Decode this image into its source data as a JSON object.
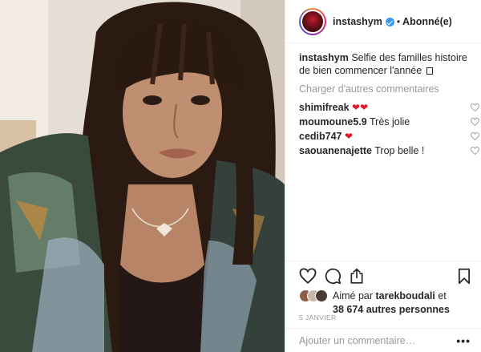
{
  "post": {
    "username": "instashym",
    "follow_status": "Abonné(e)",
    "separator": "•"
  },
  "caption": {
    "username": "instashym",
    "text": "Selfie des familles histoire de bien commencer l'année"
  },
  "comments": {
    "load_more": "Charger d'autres commentaires",
    "items": [
      {
        "username": "shimifreak",
        "text": "❤❤"
      },
      {
        "username": "moumoune5.9",
        "text": "Très jolie"
      },
      {
        "username": "cedib747",
        "text": "❤"
      },
      {
        "username": "saouanenajette",
        "text": "Trop belle !"
      }
    ]
  },
  "likes": {
    "prefix": "Aimé par",
    "user": "tarekboudali",
    "connector": "et",
    "others": "38 674 autres personnes"
  },
  "date": "5 JANVIER",
  "add_comment": {
    "placeholder": "Ajouter un commentaire…",
    "more": "•••"
  },
  "icons": {
    "verified": "verified-badge-icon",
    "comment_like": "heart-outline-icon",
    "like": "heart-outline-icon",
    "comment": "speech-bubble-icon",
    "share": "share-icon",
    "save": "bookmark-icon"
  },
  "colors": {
    "verified": "#3897f0",
    "muted_text": "#999999",
    "heart_emoji": "#e0162b"
  }
}
